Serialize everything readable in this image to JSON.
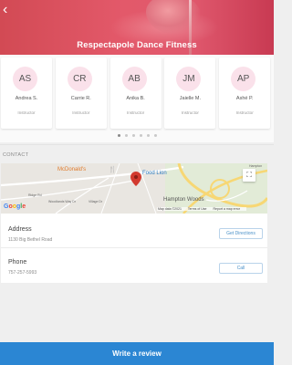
{
  "header": {
    "title": "Respectapole Dance Fitness",
    "back_icon": "chevron-left-icon",
    "back_glyph": "‹"
  },
  "instructors": [
    {
      "initials": "AS",
      "name": "Andrea S.",
      "role": "Instructor"
    },
    {
      "initials": "CR",
      "name": "Carrie R.",
      "role": "Instructor"
    },
    {
      "initials": "AB",
      "name": "Anika B.",
      "role": "Instructor"
    },
    {
      "initials": "JM",
      "name": "Jaielle M.",
      "role": "Instructor"
    },
    {
      "initials": "AP",
      "name": "Ashé P.",
      "role": "Instructor"
    }
  ],
  "pager": {
    "count": 6,
    "active": 0
  },
  "contact": {
    "heading": "CONTACT",
    "map": {
      "places": [
        "McDonald's",
        "Food Lion",
        "Hampton Woods"
      ],
      "streets": [
        "Ridge Rd",
        "Woodlands Way Dr",
        "Village Dr",
        "Hampton"
      ],
      "logo": "Google",
      "footer": [
        "Map data ©2021",
        "Terms of Use",
        "Report a map error"
      ],
      "fullscreen_glyph": "⛶"
    },
    "address": {
      "label": "Address",
      "value": "1130 Big Bethel Road",
      "button": "Get Directions"
    },
    "phone": {
      "label": "Phone",
      "value": "757-257-5993",
      "button": "Call"
    }
  },
  "review_button": "Write a review",
  "colors": {
    "accent": "#2b86d3",
    "hero": "#e0586d",
    "avatar_bg": "#fae1ea",
    "button_text": "#4a90c8"
  }
}
